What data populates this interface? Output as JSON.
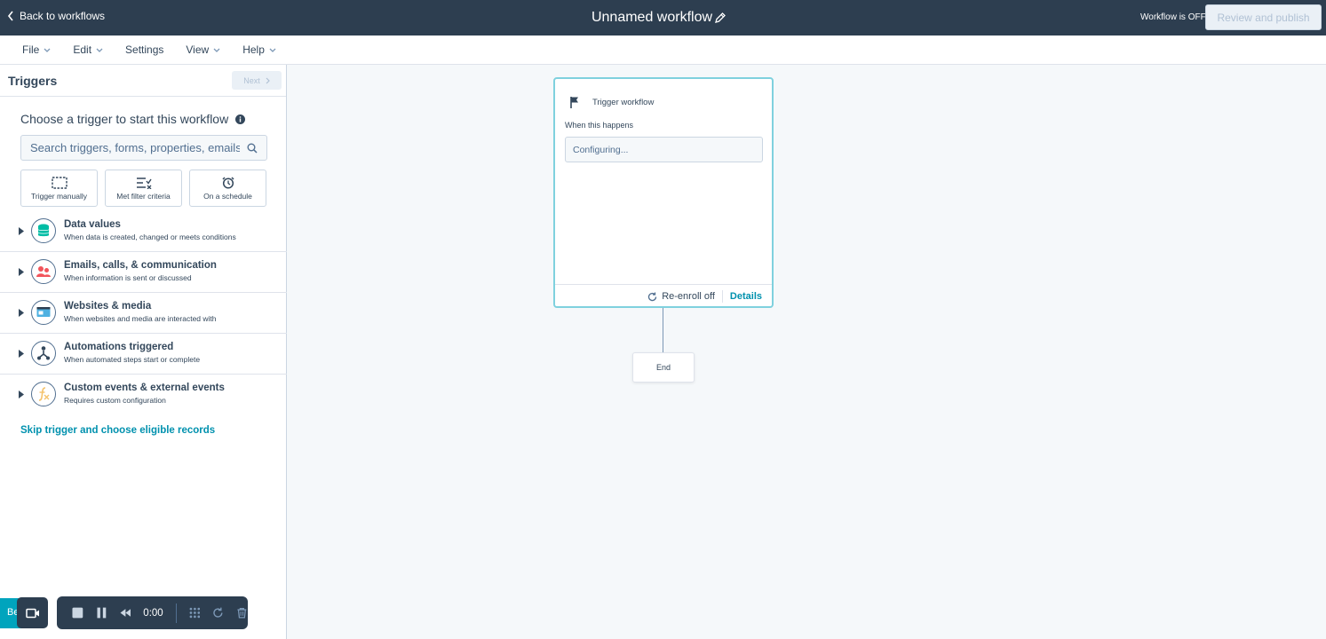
{
  "topbar": {
    "back_label": "Back to workflows",
    "workflow_name": "Unnamed workflow",
    "status_text": "Workflow is OFF",
    "publish_label": "Review and publish"
  },
  "menu": {
    "items": [
      {
        "label": "File",
        "has_caret": true
      },
      {
        "label": "Edit",
        "has_caret": true
      },
      {
        "label": "Settings",
        "has_caret": false
      },
      {
        "label": "View",
        "has_caret": true
      },
      {
        "label": "Help",
        "has_caret": true
      }
    ]
  },
  "panel": {
    "title": "Triggers",
    "next_label": "Next",
    "choose_title": "Choose a trigger to start this workflow",
    "search_placeholder": "Search triggers, forms, properties, emails...",
    "cards": [
      {
        "label": "Trigger manually",
        "icon": "dashed-box-icon"
      },
      {
        "label": "Met filter criteria",
        "icon": "filter-list-icon"
      },
      {
        "label": "On a schedule",
        "icon": "alarm-clock-icon"
      }
    ],
    "categories": [
      {
        "title": "Data values",
        "subtitle": "When data is created, changed or meets conditions",
        "icon": "database-icon"
      },
      {
        "title": "Emails, calls, & communication",
        "subtitle": "When information is sent or discussed",
        "icon": "people-icon"
      },
      {
        "title": "Websites & media",
        "subtitle": "When websites and media are interacted with",
        "icon": "browser-icon"
      },
      {
        "title": "Automations triggered",
        "subtitle": "When automated steps start or complete",
        "icon": "automation-icon"
      },
      {
        "title": "Custom events & external events",
        "subtitle": "Requires custom configuration",
        "icon": "function-icon"
      }
    ],
    "skip_label": "Skip trigger and choose eligible records"
  },
  "canvas": {
    "node_title": "Trigger workflow",
    "node_subtitle": "When this happens",
    "node_box_text": "Configuring...",
    "reenroll_label": "Re-enroll off",
    "details_label": "Details",
    "end_label": "End"
  },
  "recorder": {
    "beta_label": "Be",
    "time": "0:00"
  },
  "colors": {
    "topbar_bg": "#2d3e50",
    "accent_teal": "#0091ae",
    "node_border": "#7fd1de",
    "beta_tab": "#00a4bd"
  }
}
